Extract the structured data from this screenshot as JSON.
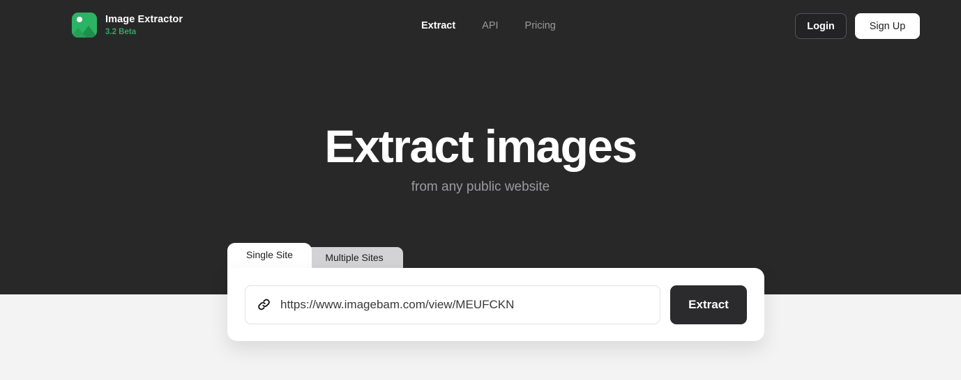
{
  "brand": {
    "name": "Image Extractor",
    "version": "3.2 Beta",
    "logo_icon": "image-mountain-icon",
    "logo_color": "#2bb463",
    "version_color": "#2fa865"
  },
  "nav": {
    "links": [
      {
        "label": "Extract",
        "active": true
      },
      {
        "label": "API",
        "active": false
      },
      {
        "label": "Pricing",
        "active": false
      }
    ],
    "login_label": "Login",
    "signup_label": "Sign Up"
  },
  "hero": {
    "title": "Extract images",
    "subtitle": "from any public website",
    "background_color": "#282829",
    "title_color": "#ffffff",
    "subtitle_color": "#9b9b9e"
  },
  "extractor": {
    "tabs": [
      {
        "label": "Single Site",
        "active": true
      },
      {
        "label": "Multiple Sites",
        "active": false
      }
    ],
    "url_input": {
      "value": "https://www.imagebam.com/view/MEUFCKN",
      "placeholder": "https://example.com",
      "icon": "link-icon"
    },
    "extract_button_label": "Extract",
    "card_background": "#ffffff",
    "inactive_tab_color": "#d3d3d6"
  },
  "page": {
    "background_color": "#f3f3f3"
  }
}
